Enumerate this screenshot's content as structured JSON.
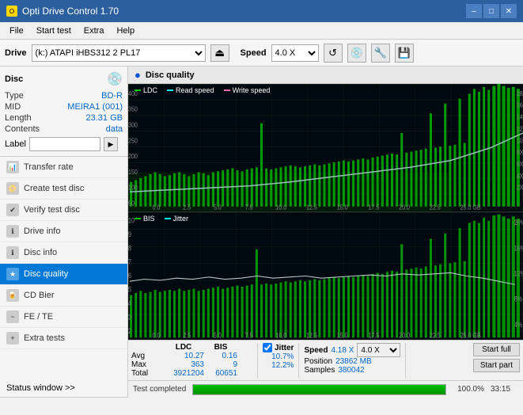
{
  "titlebar": {
    "title": "Opti Drive Control 1.70",
    "icon": "O",
    "min_btn": "–",
    "max_btn": "□",
    "close_btn": "✕"
  },
  "menubar": {
    "items": [
      "File",
      "Start test",
      "Extra",
      "Help"
    ]
  },
  "toolbar": {
    "drive_label": "Drive",
    "drive_value": "(k:) ATAPI iHBS312  2 PL17",
    "speed_label": "Speed",
    "speed_value": "4.0 X"
  },
  "disc": {
    "title": "Disc",
    "type_label": "Type",
    "type_value": "BD-R",
    "mid_label": "MID",
    "mid_value": "MEIRA1 (001)",
    "length_label": "Length",
    "length_value": "23.31 GB",
    "contents_label": "Contents",
    "contents_value": "data",
    "label_label": "Label"
  },
  "nav": {
    "items": [
      {
        "id": "transfer-rate",
        "label": "Transfer rate",
        "active": false
      },
      {
        "id": "create-test-disc",
        "label": "Create test disc",
        "active": false
      },
      {
        "id": "verify-test-disc",
        "label": "Verify test disc",
        "active": false
      },
      {
        "id": "drive-info",
        "label": "Drive info",
        "active": false
      },
      {
        "id": "disc-info",
        "label": "Disc info",
        "active": false
      },
      {
        "id": "disc-quality",
        "label": "Disc quality",
        "active": true
      },
      {
        "id": "cd-bier",
        "label": "CD Bier",
        "active": false
      },
      {
        "id": "fe-te",
        "label": "FE / TE",
        "active": false
      },
      {
        "id": "extra-tests",
        "label": "Extra tests",
        "active": false
      }
    ]
  },
  "status_window": "Status window >>",
  "content": {
    "header_icon": "●",
    "title": "Disc quality"
  },
  "chart_top": {
    "legend": [
      {
        "label": "LDC",
        "color": "#00aa00"
      },
      {
        "label": "Read speed",
        "color": "#00ffff"
      },
      {
        "label": "Write speed",
        "color": "#ff69b4"
      }
    ],
    "y_axis": [
      "400",
      "350",
      "300",
      "250",
      "200",
      "150",
      "100",
      "50"
    ],
    "y_axis_right": [
      "18X",
      "16X",
      "14X",
      "12X",
      "10X",
      "8X",
      "6X",
      "4X",
      "2X"
    ],
    "x_axis": [
      "0.0",
      "2.5",
      "5.0",
      "7.5",
      "10.0",
      "12.5",
      "15.0",
      "17.5",
      "20.0",
      "22.5",
      "25.0 GB"
    ]
  },
  "chart_bottom": {
    "legend": [
      {
        "label": "BIS",
        "color": "#00aa00"
      },
      {
        "label": "Jitter",
        "color": "#00ffff"
      }
    ],
    "y_axis": [
      "10",
      "9",
      "8",
      "7",
      "6",
      "5",
      "4",
      "3",
      "2",
      "1"
    ],
    "y_axis_right": [
      "20%",
      "16%",
      "12%",
      "8%",
      "4%"
    ],
    "x_axis": [
      "0.0",
      "2.5",
      "5.0",
      "7.5",
      "10.0",
      "12.5",
      "15.0",
      "17.5",
      "20.0",
      "22.5",
      "25.0 GB"
    ]
  },
  "stats": {
    "ldc_label": "LDC",
    "bis_label": "BIS",
    "jitter_label": "Jitter",
    "jitter_checked": true,
    "speed_label": "Speed",
    "speed_value": "4.18 X",
    "speed_select": "4.0 X",
    "avg_label": "Avg",
    "avg_ldc": "10.27",
    "avg_bis": "0.16",
    "avg_jitter": "10.7%",
    "max_label": "Max",
    "max_ldc": "363",
    "max_bis": "9",
    "max_jitter": "12.2%",
    "total_label": "Total",
    "total_ldc": "3921204",
    "total_bis": "60651",
    "position_label": "Position",
    "position_value": "23862 MB",
    "samples_label": "Samples",
    "samples_value": "380042",
    "start_full": "Start full",
    "start_part": "Start part"
  },
  "progressbar": {
    "percent": "100.0%",
    "time": "33:15",
    "status": "Test completed"
  }
}
